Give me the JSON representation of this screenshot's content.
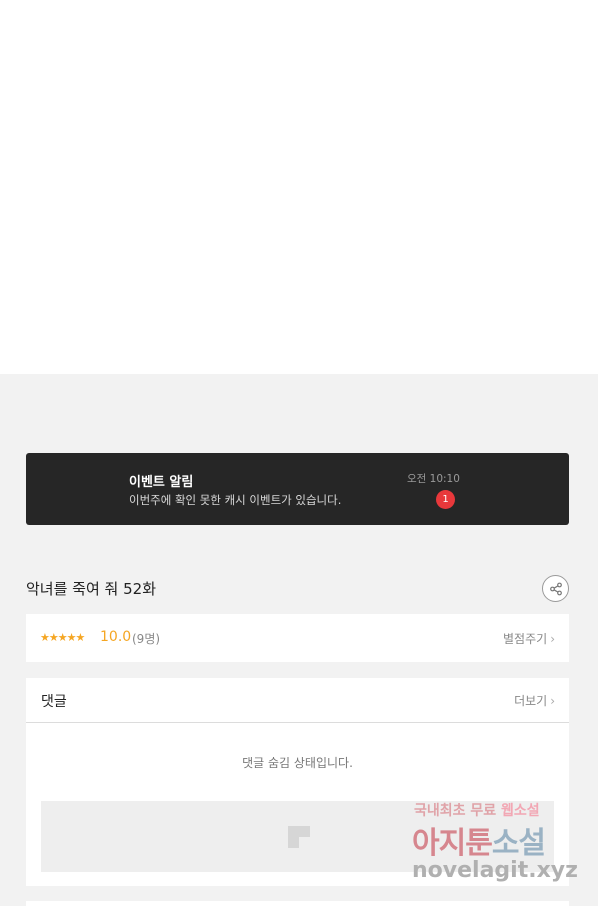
{
  "notification": {
    "title": "이벤트 알림",
    "body": "이번주에 확인 못한 캐시 이벤트가 있습니다.",
    "time": "오전 10:10",
    "badge": "1"
  },
  "episode": {
    "title": "악녀를 죽여 줘 52화"
  },
  "rating": {
    "stars": "★★★★★",
    "score": "10.0",
    "count": "(9명)",
    "rate_label": "별점주기"
  },
  "comments": {
    "title": "댓글",
    "more_label": "더보기",
    "hidden_message": "댓글 숨김 상태입니다."
  },
  "watermark": {
    "line1_a": "국내최초 무료",
    "line1_b": "웹소설",
    "line2_a": "아지툰",
    "line2_b": "소설",
    "line3": "novelagit.xyz"
  },
  "icons": {
    "share": "share-icon",
    "chevron": "chevron-right-icon",
    "thumb": "image-placeholder-icon"
  },
  "colors": {
    "banner_bg": "#262626",
    "badge": "#e8383b",
    "star": "#f5a623",
    "background": "#f2f2f2"
  }
}
